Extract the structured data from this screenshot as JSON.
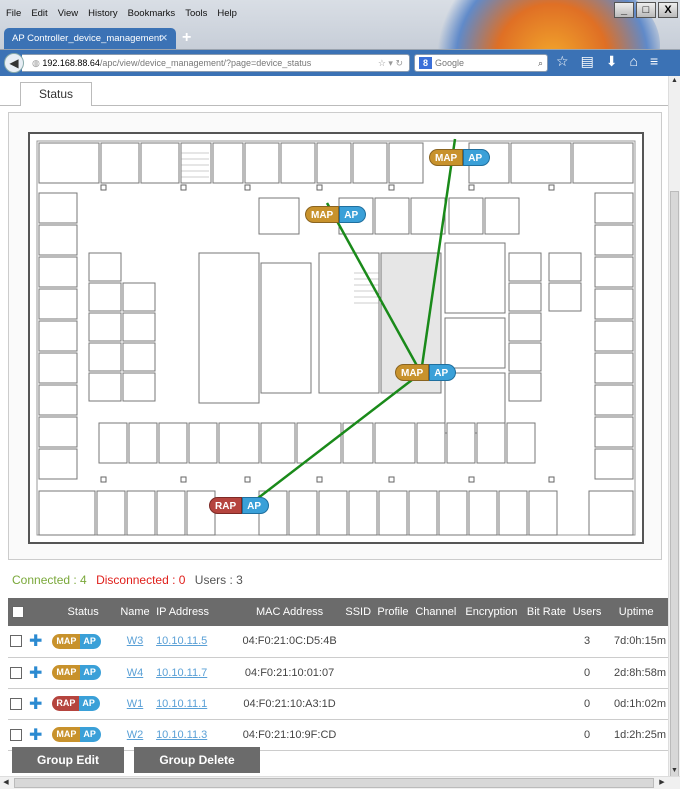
{
  "browser": {
    "menu": [
      "File",
      "Edit",
      "View",
      "History",
      "Bookmarks",
      "Tools",
      "Help"
    ],
    "tab_title": "AP Controller_device_management",
    "url_host": "192.168.88.64",
    "url_path": "/apc/view/device_management/?page=device_status",
    "search_placeholder": "Google",
    "window_buttons": [
      "_",
      "□",
      "X"
    ]
  },
  "page": {
    "tab_label": "Status"
  },
  "floorplan": {
    "aps": [
      {
        "type": "MAP",
        "ap": "AP"
      },
      {
        "type": "MAP",
        "ap": "AP"
      },
      {
        "type": "MAP",
        "ap": "AP"
      },
      {
        "type": "RAP",
        "ap": "AP"
      }
    ],
    "link_color": "#1a8a1a"
  },
  "summary": {
    "connected": "Connected : 4",
    "disconnected": "Disconnected : 0",
    "users": "Users : 3"
  },
  "table": {
    "headers": [
      "Status",
      "Name",
      "IP Address",
      "MAC Address",
      "SSID",
      "Profile",
      "Channel",
      "Encryption",
      "Bit Rate",
      "Users",
      "Uptime"
    ],
    "rows": [
      {
        "type": "MAP",
        "ap": "AP",
        "name": "W3",
        "ip": "10.10.11.5",
        "mac": "04:F0:21:0C:D5:4B",
        "users": "3",
        "uptime": "7d:0h:15m"
      },
      {
        "type": "MAP",
        "ap": "AP",
        "name": "W4",
        "ip": "10.10.11.7",
        "mac": "04:F0:21:10:01:07",
        "users": "0",
        "uptime": "2d:8h:58m"
      },
      {
        "type": "RAP",
        "ap": "AP",
        "name": "W1",
        "ip": "10.10.11.1",
        "mac": "04:F0:21:10:A3:1D",
        "users": "0",
        "uptime": "0d:1h:02m"
      },
      {
        "type": "MAP",
        "ap": "AP",
        "name": "W2",
        "ip": "10.10.11.3",
        "mac": "04:F0:21:10:9F:CD",
        "users": "0",
        "uptime": "1d:2h:25m"
      }
    ]
  },
  "buttons": {
    "group_edit": "Group Edit",
    "group_delete": "Group Delete"
  },
  "colors": {
    "connected": "#7aa83a",
    "disconnected": "#e0201c",
    "map_badge": "#c8922c",
    "rap_badge": "#b5443e",
    "ap_badge": "#3aa0d8",
    "table_header": "#6b6b6b"
  }
}
